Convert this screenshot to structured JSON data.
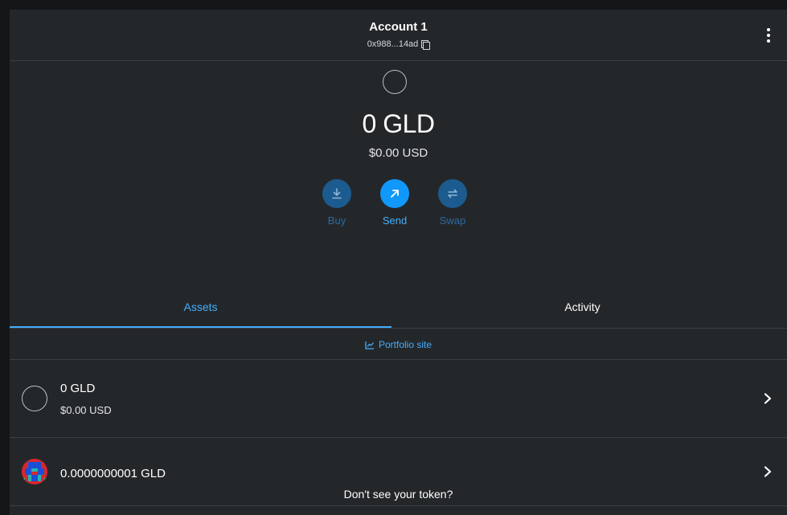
{
  "header": {
    "account_name": "Account 1",
    "address": "0x988...14ad",
    "copy_icon": "copy-icon",
    "menu_icon": "kebab-menu-icon"
  },
  "balance": {
    "amount": "0 GLD",
    "usd": "$0.00 USD"
  },
  "actions": [
    {
      "label": "Buy",
      "icon": "download-icon",
      "color": "#1c5b8f"
    },
    {
      "label": "Send",
      "icon": "arrow-up-right-icon",
      "color": "#1098fc"
    },
    {
      "label": "Swap",
      "icon": "swap-icon",
      "color": "#1c5b8f"
    }
  ],
  "tabs": [
    {
      "label": "Assets",
      "active": true
    },
    {
      "label": "Activity",
      "active": false
    }
  ],
  "portfolio": {
    "label": "Portfolio site",
    "icon": "chart-icon"
  },
  "assets": [
    {
      "amount": "0 GLD",
      "usd": "$0.00 USD"
    },
    {
      "amount": "0.0000000001 GLD",
      "usd": ""
    }
  ],
  "footer": {
    "dont_see": "Don't see your token?"
  },
  "colors": {
    "accent": "#43aefc",
    "background": "#24272a",
    "border": "#3b4046"
  }
}
